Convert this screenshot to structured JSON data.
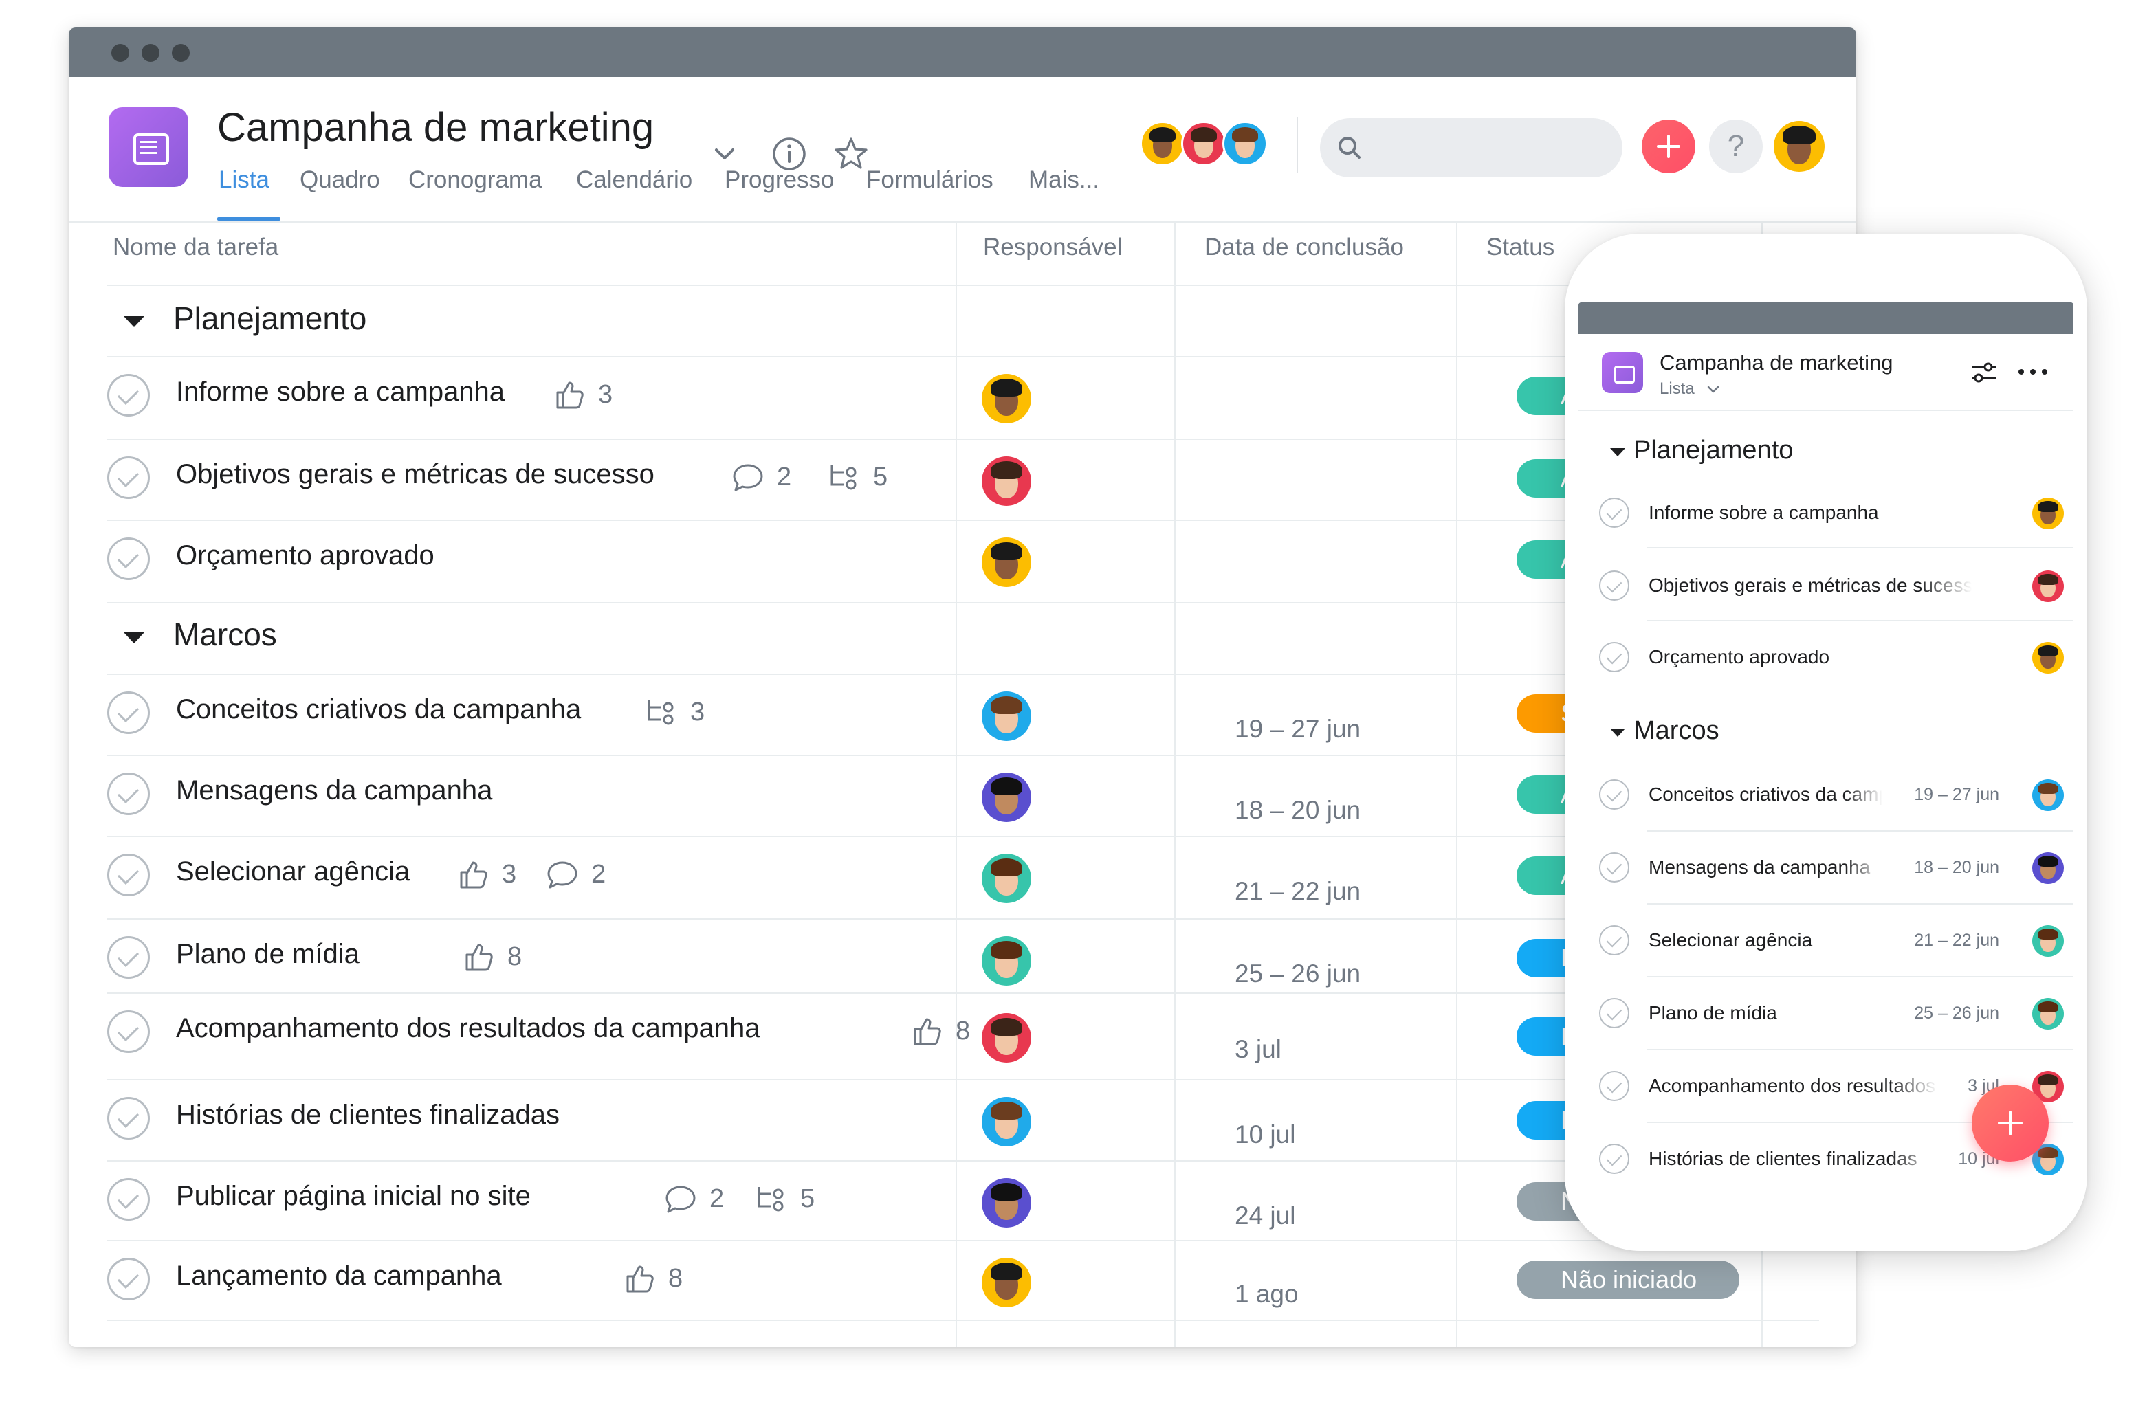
{
  "project": {
    "title": "Campanha de marketing",
    "tabs": [
      "Lista",
      "Quadro",
      "Cronograma",
      "Calendário",
      "Progresso",
      "Formulários",
      "Mais..."
    ],
    "active_tab": "Lista"
  },
  "columns": {
    "task": "Nome da tarefa",
    "assignee": "Responsável",
    "due": "Data de conclusão",
    "status": "Status"
  },
  "sections": [
    {
      "name": "Planejamento"
    },
    {
      "name": "Marcos"
    }
  ],
  "tasks": [
    {
      "name": "Informe sobre a campanha",
      "likes": "3",
      "comments": "",
      "subtasks": "",
      "due": "",
      "status": "A",
      "status_color": "#37c5ab",
      "avatar": "woman-dark-hair-yellow"
    },
    {
      "name": "Objetivos gerais e métricas de sucesso",
      "likes": "",
      "comments": "2",
      "subtasks": "5",
      "due": "",
      "status": "A",
      "status_color": "#37c5ab",
      "avatar": "woman-red"
    },
    {
      "name": "Orçamento aprovado",
      "likes": "",
      "comments": "",
      "subtasks": "",
      "due": "",
      "status": "A",
      "status_color": "#37c5ab",
      "avatar": "woman-dark-hair-yellow"
    },
    {
      "name": "Conceitos criativos da campanha",
      "likes": "",
      "comments": "",
      "subtasks": "3",
      "due": "19 – 27 jun",
      "status": "So",
      "status_color": "#fd9a00",
      "avatar": "man-glasses-teal"
    },
    {
      "name": "Mensagens da campanha",
      "likes": "",
      "comments": "",
      "subtasks": "",
      "due": "18 – 20 jun",
      "status": "A",
      "status_color": "#37c5ab",
      "avatar": "man-purple"
    },
    {
      "name": "Selecionar agência",
      "likes": "3",
      "comments": "2",
      "subtasks": "",
      "due": "21 – 22 jun",
      "status": "A",
      "status_color": "#37c5ab",
      "avatar": "man-green"
    },
    {
      "name": "Plano de mídia",
      "likes": "8",
      "comments": "",
      "subtasks": "",
      "due": "25 – 26 jun",
      "status": "Em a",
      "status_color": "#14aaf5",
      "avatar": "man-green"
    },
    {
      "name": "Acompanhamento dos resultados da campanha",
      "likes": "8",
      "comments": "",
      "subtasks": "",
      "due": "3 jul",
      "status": "Em a",
      "status_color": "#14aaf5",
      "avatar": "woman-red"
    },
    {
      "name": "Histórias de clientes finalizadas",
      "likes": "",
      "comments": "",
      "subtasks": "",
      "due": "10 jul",
      "status": "Em a",
      "status_color": "#14aaf5",
      "avatar": "man-glasses-teal"
    },
    {
      "name": "Publicar página inicial no site",
      "likes": "",
      "comments": "2",
      "subtasks": "5",
      "due": "24 jul",
      "status": "Não",
      "status_color": "#95a3ab",
      "avatar": "man-purple"
    },
    {
      "name": "Lançamento da campanha",
      "likes": "8",
      "comments": "",
      "subtasks": "",
      "due": "1 ago",
      "status": "Não iniciado",
      "status_color": "#95a3ab",
      "avatar": "woman-dark-hair-yellow"
    }
  ],
  "mobile": {
    "title": "Campanha de marketing",
    "view": "Lista",
    "sections": [
      "Planejamento",
      "Marcos"
    ],
    "tasks": [
      {
        "name": "Informe sobre a campanha",
        "due": ""
      },
      {
        "name": "Objetivos gerais e métricas de sucesso",
        "due": ""
      },
      {
        "name": "Orçamento aprovado",
        "due": ""
      },
      {
        "name": "Conceitos criativos da campanha",
        "due": "19 – 27 jun"
      },
      {
        "name": "Mensagens da campanha",
        "due": "18 – 20 jun"
      },
      {
        "name": "Selecionar agência",
        "due": "21 – 22 jun"
      },
      {
        "name": "Plano de mídia",
        "due": "25 – 26 jun"
      },
      {
        "name": "Acompanhamento dos resultados da campanha",
        "due": "3 jul"
      },
      {
        "name": "Histórias de clientes finalizadas",
        "due": "10 jul"
      }
    ]
  },
  "icons": {
    "project": "list-icon",
    "dropdown": "chevron-down-icon",
    "info": "info-icon",
    "favorite": "star-icon",
    "search": "search-icon",
    "add": "plus-icon",
    "help": "question-icon",
    "like": "thumbs-up-icon",
    "comment": "comment-icon",
    "subtask": "subtask-icon",
    "filter": "filter-icon",
    "more": "more-icon"
  },
  "colors": {
    "accent": "#3e8ede",
    "project_purple": "#a86ce8",
    "add_red": "#fc636b",
    "status_green": "#37c5ab",
    "status_orange": "#fd9a00",
    "status_blue": "#14aaf5",
    "status_gray": "#95a3ab"
  }
}
